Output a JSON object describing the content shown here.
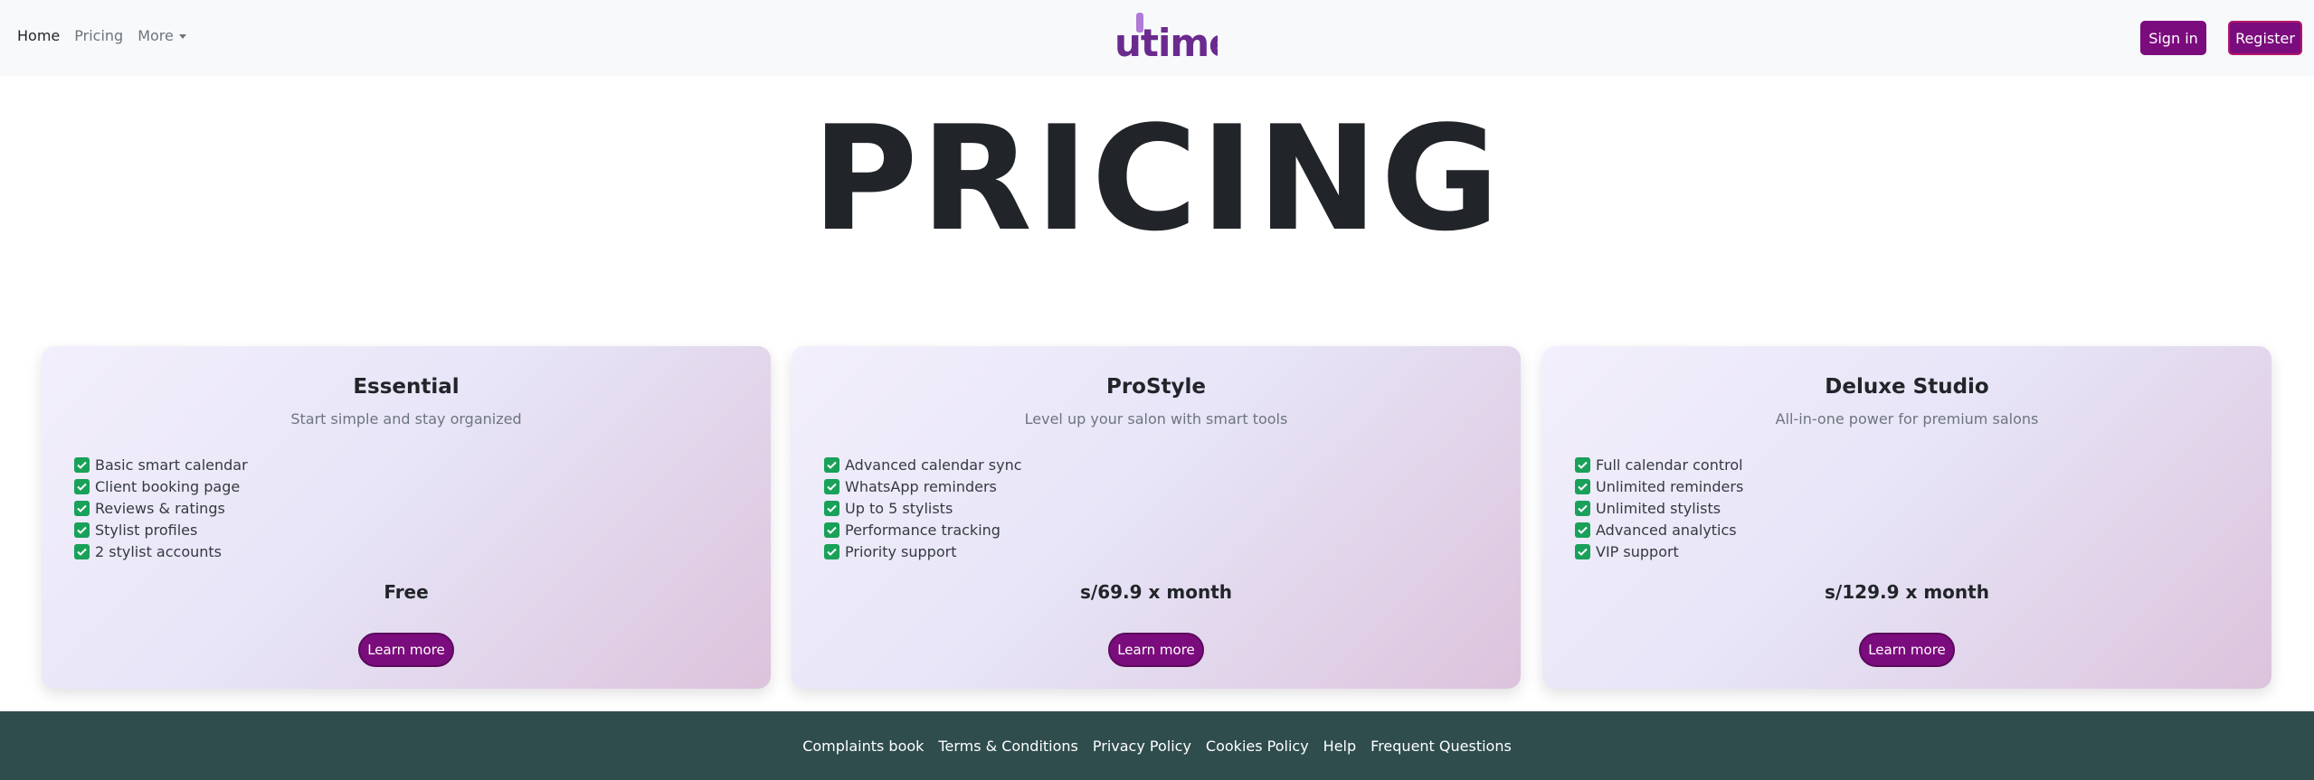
{
  "nav": {
    "links": [
      {
        "label": "Home",
        "active": true
      },
      {
        "label": "Pricing",
        "active": false
      }
    ],
    "more_label": "More",
    "logo_text": "utime",
    "sign_in_label": "Sign in",
    "register_label": "Register"
  },
  "hero": {
    "title": "PRICING"
  },
  "plans": [
    {
      "name": "Essential",
      "tagline": "Start simple and stay organized",
      "features": [
        "Basic smart calendar",
        "Client booking page",
        "Reviews & ratings",
        "Stylist profiles",
        "2 stylist accounts"
      ],
      "price": "Free",
      "cta": "Learn more"
    },
    {
      "name": "ProStyle",
      "tagline": "Level up your salon with smart tools",
      "features": [
        "Advanced calendar sync",
        "WhatsApp reminders",
        "Up to 5 stylists",
        "Performance tracking",
        "Priority support"
      ],
      "price": "s/69.9 x month",
      "cta": "Learn more"
    },
    {
      "name": "Deluxe Studio",
      "tagline": "All-in-one power for premium salons",
      "features": [
        "Full calendar control",
        "Unlimited reminders",
        "Unlimited stylists",
        "Advanced analytics",
        "VIP support"
      ],
      "price": "s/129.9 x month",
      "cta": "Learn more"
    }
  ],
  "footer": {
    "links": [
      "Complaints book",
      "Terms & Conditions",
      "Privacy Policy",
      "Cookies Policy",
      "Help",
      "Frequent Questions"
    ]
  },
  "icons": {
    "feature_check": "check-icon",
    "more_dropdown": "caret-down-icon"
  },
  "colors": {
    "brand": "#7b0c7d",
    "logo_light": "#b07ad8",
    "logo_dark": "#6a2a8e",
    "check": "#19a15a",
    "footer_bg": "#2f4d4d",
    "navbar_bg": "#f8f9fa"
  }
}
